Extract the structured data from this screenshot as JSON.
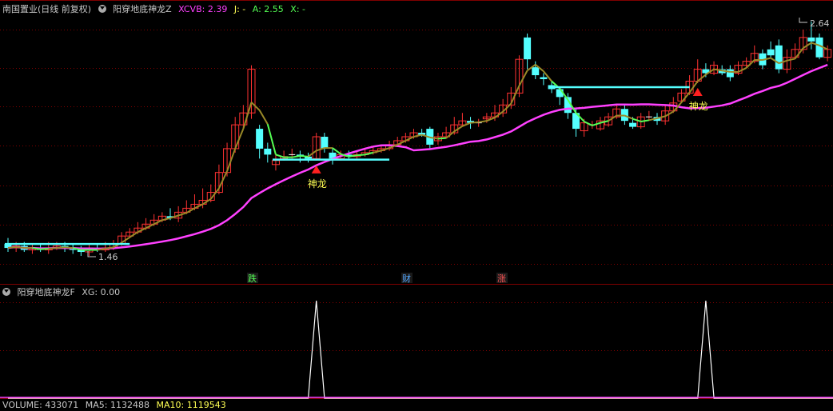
{
  "main_header": {
    "stock_title": "南国置业(日线 前复权)",
    "indicator_name": "阳穿地底神龙Z",
    "xcvb_label": "XCVB: 2.39",
    "j_label": "J: -",
    "a_label": "A: 2.55",
    "x_label": "X: -"
  },
  "sub_header": {
    "indicator_name": "阳穿地底神龙F",
    "xg_label": "XG: 0.00"
  },
  "bottom_header": {
    "volume_label": "VOLUME: 433071",
    "ma5_label": "MA5: 1132488",
    "ma10_label": "MA10: 1119543"
  },
  "price_labels": {
    "high": "2.64",
    "low": "1.46"
  },
  "signal_labels": {
    "first": "神龙",
    "second": "神龙"
  },
  "event_markers": {
    "die": "跌",
    "cai": "财",
    "zhang": "涨"
  },
  "colors": {
    "up_candle": "#ff3232",
    "down_candle": "#54ffff",
    "ma_short": "#9a8a28",
    "ma_mid": "#54ff54",
    "ma_long": "#ff40ff",
    "flat_line": "#54ffff",
    "signal": "#ffff54",
    "grid": "#800000",
    "xcvb": "#ff40ff",
    "j": "#ffff54",
    "a": "#54ff54",
    "x": "#54ff54"
  },
  "chart_data": {
    "type": "candlestick",
    "xg_signal": [
      0,
      0,
      0,
      0,
      0,
      0,
      0,
      0,
      0,
      0,
      0,
      0,
      0,
      0,
      0,
      0,
      0,
      0,
      0,
      0,
      0,
      0,
      0,
      0,
      0,
      0,
      0,
      0,
      0,
      0,
      0,
      0,
      0,
      0,
      0,
      0,
      0,
      0,
      1,
      0,
      0,
      0,
      0,
      0,
      0,
      0,
      0,
      0,
      0,
      0,
      0,
      0,
      0,
      0,
      0,
      0,
      0,
      0,
      0,
      0,
      0,
      0,
      0,
      0,
      0,
      0,
      0,
      0,
      0,
      0,
      0,
      0,
      0,
      0,
      0,
      0,
      0,
      0,
      0,
      0,
      0,
      0,
      0,
      0,
      0,
      0,
      1,
      0,
      0,
      0,
      0,
      0,
      0,
      0,
      0,
      0,
      0,
      0,
      0,
      0,
      0,
      0,
      0
    ],
    "candles": [
      [
        1.52,
        1.5,
        1.55,
        1.48
      ],
      [
        1.5,
        1.51,
        1.53,
        1.48
      ],
      [
        1.51,
        1.49,
        1.53,
        1.48
      ],
      [
        1.49,
        1.5,
        1.52,
        1.47
      ],
      [
        1.5,
        1.49,
        1.52,
        1.48
      ],
      [
        1.49,
        1.5,
        1.53,
        1.47
      ],
      [
        1.5,
        1.51,
        1.53,
        1.49
      ],
      [
        1.51,
        1.5,
        1.53,
        1.48
      ],
      [
        1.5,
        1.49,
        1.52,
        1.47
      ],
      [
        1.49,
        1.48,
        1.51,
        1.46
      ],
      [
        1.48,
        1.5,
        1.52,
        1.46
      ],
      [
        1.5,
        1.49,
        1.52,
        1.48
      ],
      [
        1.49,
        1.5,
        1.53,
        1.48
      ],
      [
        1.5,
        1.52,
        1.54,
        1.49
      ],
      [
        1.52,
        1.56,
        1.58,
        1.51
      ],
      [
        1.56,
        1.58,
        1.6,
        1.55
      ],
      [
        1.58,
        1.6,
        1.63,
        1.57
      ],
      [
        1.6,
        1.62,
        1.65,
        1.59
      ],
      [
        1.62,
        1.64,
        1.67,
        1.61
      ],
      [
        1.64,
        1.66,
        1.68,
        1.63
      ],
      [
        1.66,
        1.65,
        1.7,
        1.64
      ],
      [
        1.65,
        1.68,
        1.71,
        1.63
      ],
      [
        1.68,
        1.7,
        1.74,
        1.67
      ],
      [
        1.7,
        1.72,
        1.77,
        1.69
      ],
      [
        1.72,
        1.74,
        1.8,
        1.7
      ],
      [
        1.74,
        1.78,
        1.82,
        1.73
      ],
      [
        1.78,
        1.88,
        1.92,
        1.77
      ],
      [
        1.88,
        2.0,
        2.03,
        1.86
      ],
      [
        2.0,
        2.12,
        2.16,
        1.98
      ],
      [
        2.12,
        2.18,
        2.22,
        2.1
      ],
      [
        2.18,
        2.4,
        2.42,
        2.15
      ],
      [
        2.1,
        2.0,
        2.12,
        1.95
      ],
      [
        2.0,
        1.97,
        2.03,
        1.93
      ],
      [
        1.92,
        1.94,
        1.97,
        1.89
      ],
      [
        1.95,
        1.96,
        1.99,
        1.94
      ],
      [
        1.97,
        1.97,
        2.0,
        1.95
      ],
      [
        1.97,
        1.96,
        1.99,
        1.93
      ],
      [
        1.96,
        1.95,
        1.98,
        1.93
      ],
      [
        1.95,
        2.06,
        2.08,
        1.94
      ],
      [
        2.06,
        2.0,
        2.08,
        1.98
      ],
      [
        1.98,
        1.95,
        2.0,
        1.92
      ],
      [
        1.95,
        1.97,
        1.99,
        1.94
      ],
      [
        1.97,
        1.96,
        1.99,
        1.95
      ],
      [
        1.96,
        1.97,
        1.99,
        1.95
      ],
      [
        1.97,
        1.98,
        2.0,
        1.96
      ],
      [
        1.98,
        1.99,
        2.01,
        1.97
      ],
      [
        1.99,
        2.0,
        2.02,
        1.98
      ],
      [
        2.0,
        2.02,
        2.04,
        1.99
      ],
      [
        2.02,
        2.04,
        2.06,
        2.01
      ],
      [
        2.04,
        2.06,
        2.08,
        2.03
      ],
      [
        2.06,
        2.08,
        2.1,
        2.05
      ],
      [
        2.08,
        2.07,
        2.1,
        2.06
      ],
      [
        2.1,
        2.02,
        2.11,
        2.0
      ],
      [
        2.04,
        2.06,
        2.08,
        2.02
      ],
      [
        2.06,
        2.08,
        2.11,
        2.05
      ],
      [
        2.08,
        2.12,
        2.16,
        2.07
      ],
      [
        2.12,
        2.14,
        2.18,
        2.11
      ],
      [
        2.14,
        2.13,
        2.16,
        2.1
      ],
      [
        2.13,
        2.13,
        2.15,
        2.11
      ],
      [
        2.15,
        2.16,
        2.18,
        2.13
      ],
      [
        2.16,
        2.18,
        2.22,
        2.14
      ],
      [
        2.18,
        2.22,
        2.25,
        2.16
      ],
      [
        2.22,
        2.28,
        2.31,
        2.2
      ],
      [
        2.28,
        2.45,
        2.47,
        2.26
      ],
      [
        2.56,
        2.45,
        2.58,
        2.4
      ],
      [
        2.41,
        2.37,
        2.44,
        2.35
      ],
      [
        2.36,
        2.35,
        2.38,
        2.32
      ],
      [
        2.32,
        2.3,
        2.34,
        2.28
      ],
      [
        2.3,
        2.26,
        2.31,
        2.22
      ],
      [
        2.26,
        2.18,
        2.28,
        2.15
      ],
      [
        2.18,
        2.1,
        2.2,
        2.06
      ],
      [
        2.09,
        2.13,
        2.15,
        2.06
      ],
      [
        2.12,
        2.12,
        2.14,
        2.1
      ],
      [
        2.1,
        2.14,
        2.16,
        2.09
      ],
      [
        2.12,
        2.16,
        2.18,
        2.11
      ],
      [
        2.16,
        2.2,
        2.22,
        2.15
      ],
      [
        2.2,
        2.14,
        2.22,
        2.12
      ],
      [
        2.13,
        2.11,
        2.16,
        2.1
      ],
      [
        2.11,
        2.16,
        2.18,
        2.1
      ],
      [
        2.16,
        2.16,
        2.19,
        2.14
      ],
      [
        2.16,
        2.14,
        2.18,
        2.12
      ],
      [
        2.14,
        2.19,
        2.22,
        2.12
      ],
      [
        2.19,
        2.23,
        2.26,
        2.18
      ],
      [
        2.24,
        2.28,
        2.3,
        2.23
      ],
      [
        2.28,
        2.34,
        2.37,
        2.27
      ],
      [
        2.34,
        2.4,
        2.45,
        2.33
      ],
      [
        2.4,
        2.38,
        2.43,
        2.36
      ],
      [
        2.38,
        2.42,
        2.44,
        2.37
      ],
      [
        2.4,
        2.38,
        2.42,
        2.37
      ],
      [
        2.4,
        2.36,
        2.42,
        2.34
      ],
      [
        2.38,
        2.42,
        2.44,
        2.37
      ],
      [
        2.42,
        2.44,
        2.46,
        2.41
      ],
      [
        2.44,
        2.48,
        2.52,
        2.43
      ],
      [
        2.48,
        2.42,
        2.5,
        2.4
      ],
      [
        2.5,
        2.47,
        2.54,
        2.46
      ],
      [
        2.52,
        2.4,
        2.55,
        2.38
      ],
      [
        2.4,
        2.46,
        2.5,
        2.38
      ],
      [
        2.46,
        2.5,
        2.53,
        2.45
      ],
      [
        2.5,
        2.56,
        2.6,
        2.48
      ],
      [
        2.56,
        2.54,
        2.64,
        2.5
      ],
      [
        2.56,
        2.46,
        2.58,
        2.45
      ],
      [
        2.46,
        2.5,
        2.52,
        2.44
      ]
    ]
  }
}
